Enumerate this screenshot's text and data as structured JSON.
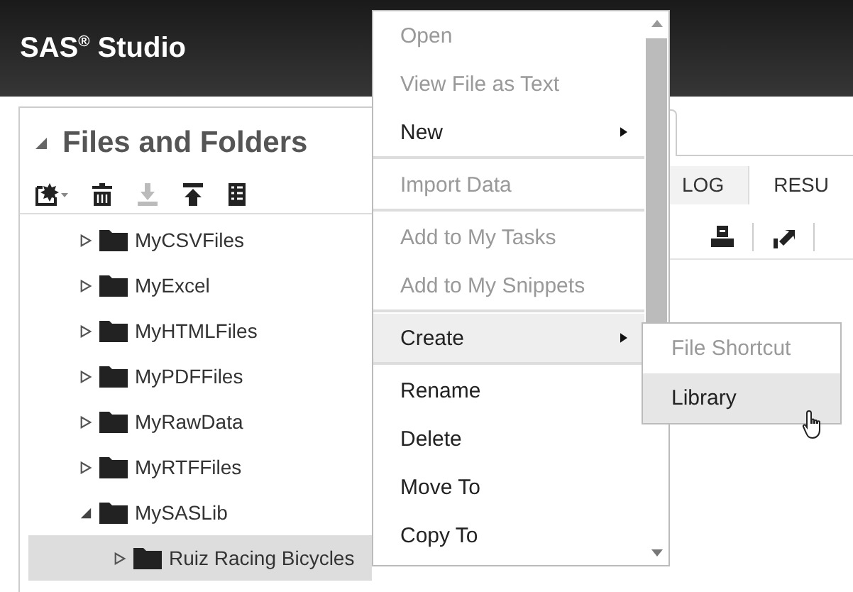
{
  "header": {
    "title": "SAS$^{®}$ Studio"
  },
  "panel": {
    "title": "Files and Folders",
    "expanded": true
  },
  "tree": [
    {
      "label": "MyCSVFiles",
      "expanded": false,
      "selected": false
    },
    {
      "label": "MyExcel",
      "expanded": false,
      "selected": false
    },
    {
      "label": "MyHTMLFiles",
      "expanded": false,
      "selected": false
    },
    {
      "label": "MyPDFFiles",
      "expanded": false,
      "selected": false
    },
    {
      "label": "MyRawData",
      "expanded": false,
      "selected": false
    },
    {
      "label": "MyRTFFiles",
      "expanded": false,
      "selected": false
    },
    {
      "label": "MySASLib",
      "expanded": true,
      "selected": false,
      "children": [
        {
          "label": "Ruiz Racing Bicycles",
          "expanded": false,
          "selected": true
        }
      ]
    }
  ],
  "output_tabs": [
    {
      "label": "LOG",
      "selected": false
    },
    {
      "label": "RESU",
      "selected": false
    }
  ],
  "context_menu": {
    "items": [
      {
        "label": "Open",
        "disabled": true,
        "submenu": false,
        "selected": false,
        "separator_after": false
      },
      {
        "label": "View File as Text",
        "disabled": true,
        "submenu": false,
        "selected": false,
        "separator_after": false
      },
      {
        "label": "New",
        "disabled": false,
        "submenu": true,
        "selected": false,
        "separator_after": true
      },
      {
        "label": "Import Data",
        "disabled": true,
        "submenu": false,
        "selected": false,
        "separator_after": true
      },
      {
        "label": "Add to My Tasks",
        "disabled": true,
        "submenu": false,
        "selected": false,
        "separator_after": false
      },
      {
        "label": "Add to My Snippets",
        "disabled": true,
        "submenu": false,
        "selected": false,
        "separator_after": true
      },
      {
        "label": "Create",
        "disabled": false,
        "submenu": true,
        "selected": true,
        "separator_after": true
      },
      {
        "label": "Rename",
        "disabled": false,
        "submenu": false,
        "selected": false,
        "separator_after": false
      },
      {
        "label": "Delete",
        "disabled": false,
        "submenu": false,
        "selected": false,
        "separator_after": false
      },
      {
        "label": "Move To",
        "disabled": false,
        "submenu": false,
        "selected": false,
        "separator_after": false
      },
      {
        "label": "Copy To",
        "disabled": false,
        "submenu": false,
        "selected": false,
        "separator_after": false
      }
    ]
  },
  "submenu": {
    "items": [
      {
        "label": "File Shortcut",
        "disabled": true,
        "selected": false
      },
      {
        "label": "Library",
        "disabled": false,
        "selected": true
      }
    ]
  }
}
